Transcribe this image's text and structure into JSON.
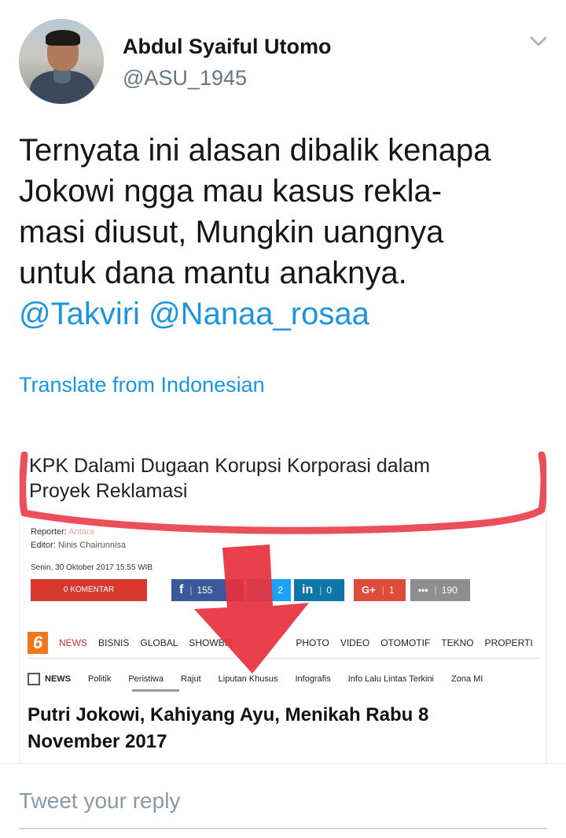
{
  "author": {
    "name": "Abdul Syaiful Utomo",
    "handle": "@ASU_1945"
  },
  "tweet": {
    "lines": [
      "Ternyata ini alasan dibalik kenapa",
      "Jokowi ngga mau kasus rekla-",
      "masi diusut, Mungkin uangnya",
      "untuk dana mantu anaknya."
    ],
    "mentions": [
      "@Takviri",
      "@Nanaa_rosaa"
    ]
  },
  "translate_label": "Translate from Indonesian",
  "media": {
    "headline_lines": [
      "KPK Dalami Dugaan Korupsi Korporasi dalam",
      "Proyek Reklamasi"
    ],
    "reporter_label": "Reporter:",
    "reporter_name": "Antara",
    "editor_label": "Editor:",
    "editor_name": "Ninis Chairunnisa",
    "date": "Senin, 30 Oktober 2017 15:55 WIB",
    "komentar_label": "0 KOMENTAR",
    "share": {
      "facebook_count": "155",
      "twitter_count": "2",
      "linkedin_count": "0",
      "gplus_count": "1",
      "more_count": "190"
    },
    "nav1": [
      "NEWS",
      "BISNIS",
      "GLOBAL",
      "SHOWBIZ",
      "",
      "PHOTO",
      "VIDEO",
      "OTOMOTIF",
      "TEKNO",
      "PROPERTI"
    ],
    "logo": "6",
    "nav2_label": "NEWS",
    "nav2": [
      "Politik",
      "Peristiwa",
      "Rajut",
      "Liputan Khusus",
      "Infografis",
      "Info Lalu Lintas Terkini",
      "Zona MI"
    ],
    "article_title_lines": [
      "Putri Jokowi, Kahiyang Ayu, Menikah Rabu 8",
      "November 2017"
    ]
  },
  "reply_placeholder": "Tweet your reply",
  "colors": {
    "link": "#1b95e0",
    "annotation_red": "#e8303d"
  },
  "icons": [
    "avatar",
    "chevron-down-icon",
    "facebook-icon",
    "twitter-icon",
    "linkedin-icon",
    "google-plus-icon",
    "more-icon",
    "news-icon"
  ]
}
